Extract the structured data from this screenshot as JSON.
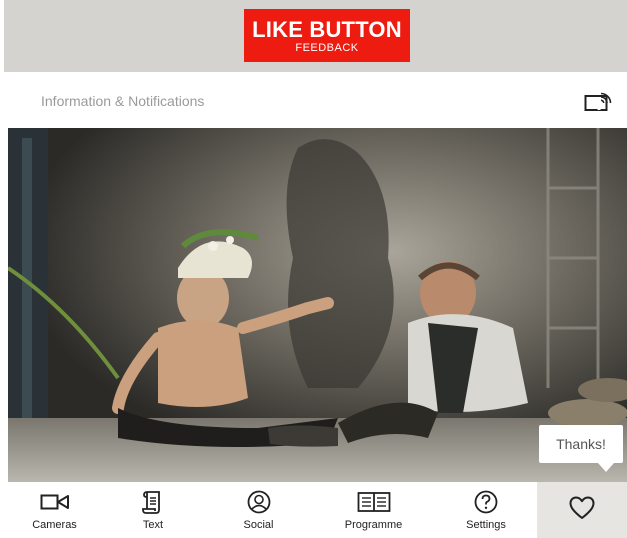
{
  "banner": {
    "title": "LIKE BUTTON",
    "subtitle": "FEEDBACK",
    "color": "#ee1b10"
  },
  "header": {
    "title": "Information & Notifications",
    "cast_icon": "cast-icon"
  },
  "stage_image": {
    "description_icon": "photo"
  },
  "tooltip": {
    "text": "Thanks!"
  },
  "nav": {
    "cameras": {
      "label": "Cameras",
      "icon": "video-camera-icon"
    },
    "text": {
      "label": "Text",
      "icon": "scroll-icon"
    },
    "social": {
      "label": "Social",
      "icon": "person-circle-icon"
    },
    "programme": {
      "label": "Programme",
      "icon": "open-book-icon"
    },
    "settings": {
      "label": "Settings",
      "icon": "help-circle-icon"
    },
    "like": {
      "icon": "heart-icon"
    }
  }
}
